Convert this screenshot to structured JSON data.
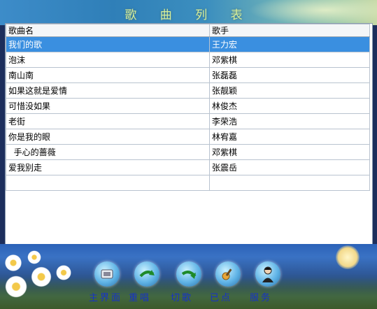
{
  "window": {
    "title": "歌 曲 列 表"
  },
  "table": {
    "columns": [
      "歌曲名",
      "歌手"
    ],
    "rows": [
      {
        "song": "我们的歌",
        "singer": "王力宏",
        "selected": true
      },
      {
        "song": "泡沫",
        "singer": "邓紫棋",
        "selected": false
      },
      {
        "song": "南山南",
        "singer": "张磊磊",
        "selected": false
      },
      {
        "song": "如果这就是爱情",
        "singer": "张靓颖",
        "selected": false
      },
      {
        "song": "可惜没如果",
        "singer": "林俊杰",
        "selected": false
      },
      {
        "song": "老街",
        "singer": "李荣浩",
        "selected": false
      },
      {
        "song": "你是我的眼",
        "singer": "林宥嘉",
        "selected": false
      },
      {
        "song": "  手心的蔷薇",
        "singer": "邓紫棋",
        "selected": false
      },
      {
        "song": "爱我别走",
        "singer": "张震岳",
        "selected": false
      },
      {
        "song": "",
        "singer": "",
        "selected": false
      }
    ]
  },
  "nav": [
    {
      "label": "主界面",
      "icon": "home-icon"
    },
    {
      "label": "重唱",
      "icon": "replay-icon"
    },
    {
      "label": "切歌",
      "icon": "skip-icon"
    },
    {
      "label": "已点",
      "icon": "guitar-icon"
    },
    {
      "label": "服务",
      "icon": "service-person-icon"
    }
  ],
  "colors": {
    "selected_row": "#3a8fe0",
    "nav_label": "#1632c8",
    "title": "#d9f09a"
  }
}
